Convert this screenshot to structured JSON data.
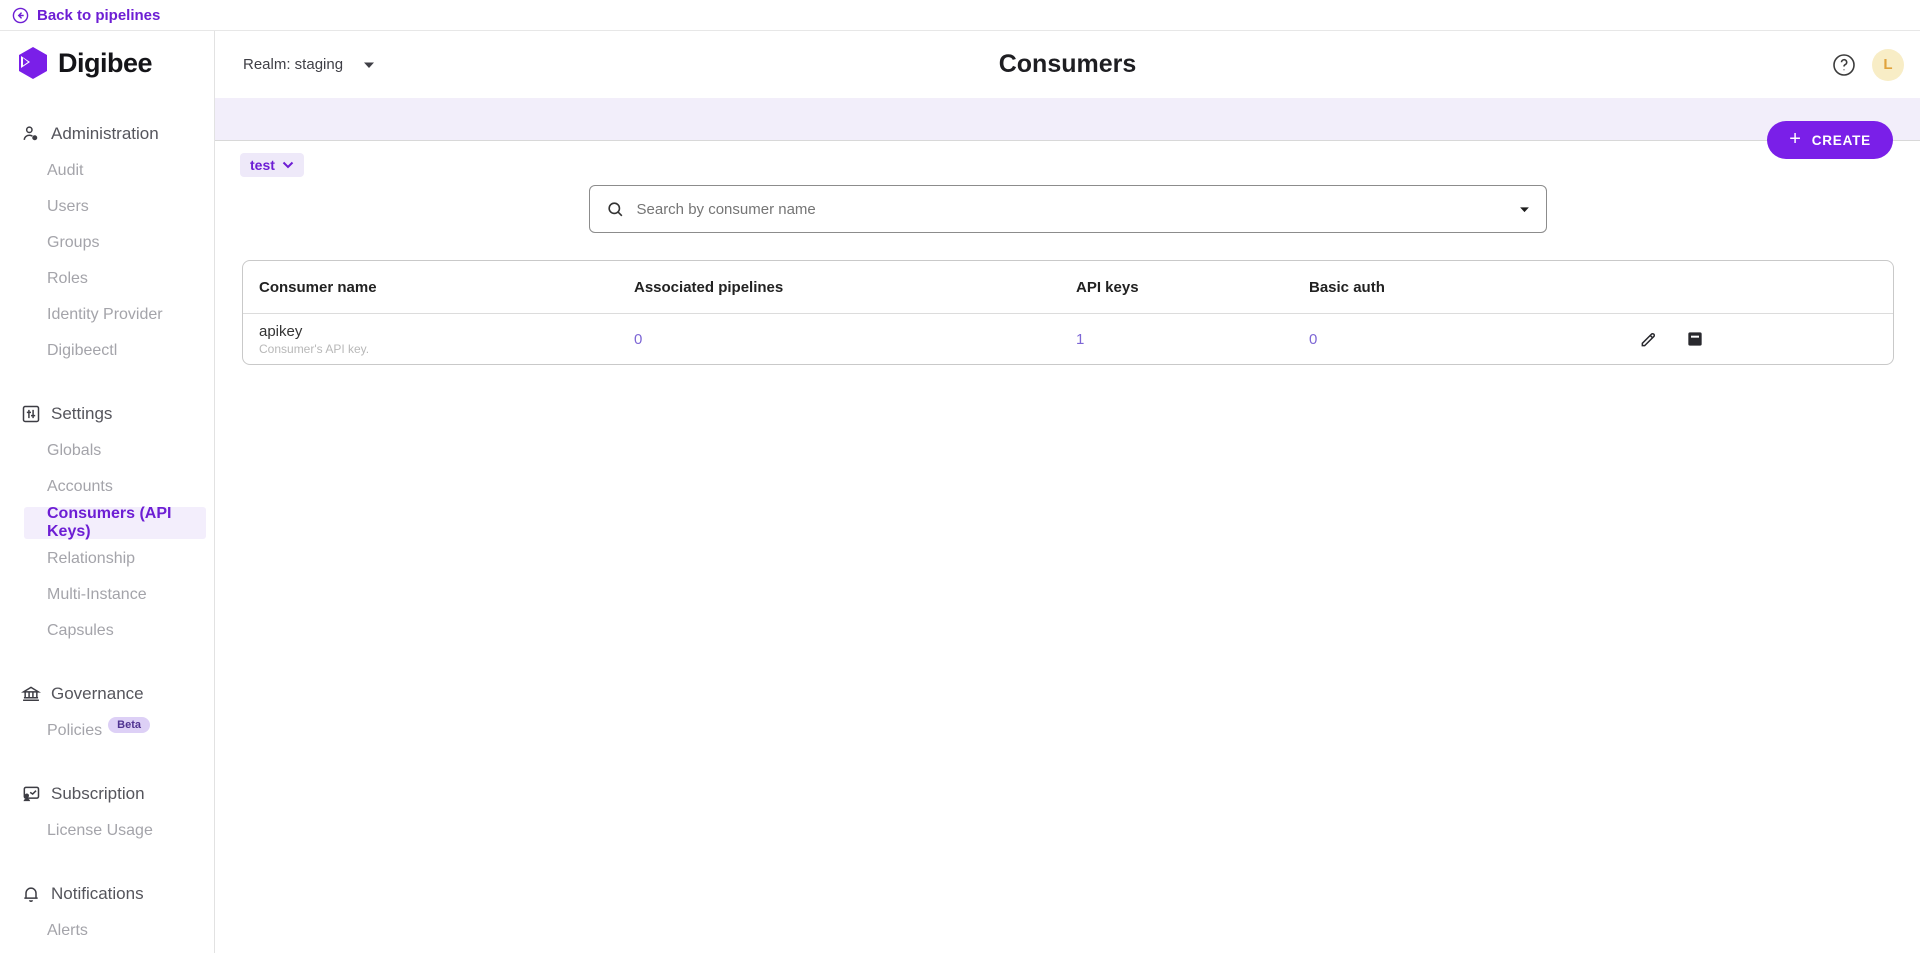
{
  "topbar": {
    "back_label": "Back to pipelines",
    "back_icon": "arrow-left-circle"
  },
  "brand": {
    "name": "Digibee",
    "logo_icon": "digibee-hexagon",
    "accent_color": "#7a1fe8"
  },
  "header": {
    "realm_label": "Realm: staging",
    "realm_caret_icon": "caret-down",
    "title": "Consumers",
    "help_icon": "question-mark-circle",
    "avatar_initial": "L"
  },
  "toolbar": {
    "create_label": "CREATE",
    "create_plus": "+",
    "env_chip_label": "test",
    "env_chip_icon": "chevron-down"
  },
  "search": {
    "placeholder": "Search by consumer name",
    "icon": "search-icon",
    "caret_icon": "caret-down"
  },
  "sidebar": {
    "sections": [
      {
        "label": "Administration",
        "icon": "user-admin-icon",
        "items": [
          {
            "label": "Audit"
          },
          {
            "label": "Users"
          },
          {
            "label": "Groups"
          },
          {
            "label": "Roles"
          },
          {
            "label": "Identity Provider"
          },
          {
            "label": "Digibeectl"
          }
        ]
      },
      {
        "label": "Settings",
        "icon": "sliders-box-icon",
        "items": [
          {
            "label": "Globals"
          },
          {
            "label": "Accounts"
          },
          {
            "label": "Consumers (API Keys)",
            "active": true
          },
          {
            "label": "Relationship"
          },
          {
            "label": "Multi-Instance"
          },
          {
            "label": "Capsules"
          }
        ]
      },
      {
        "label": "Governance",
        "icon": "bank-icon",
        "items": [
          {
            "label": "Policies",
            "badge": "Beta"
          }
        ]
      },
      {
        "label": "Subscription",
        "icon": "presentation-user-icon",
        "items": [
          {
            "label": "License Usage"
          }
        ]
      },
      {
        "label": "Notifications",
        "icon": "bell-icon",
        "items": [
          {
            "label": "Alerts"
          }
        ]
      }
    ]
  },
  "table": {
    "headers": [
      "Consumer name",
      "Associated pipelines",
      "API keys",
      "Basic auth"
    ],
    "rows": [
      {
        "name": "apikey",
        "description": "Consumer's API key.",
        "associated_pipelines": "0",
        "api_keys": "1",
        "basic_auth": "0",
        "actions": [
          "edit-icon",
          "archive-icon"
        ]
      }
    ]
  },
  "colors": {
    "accent": "#6d1ed4",
    "button_purple": "#7a1fe8",
    "band_lavender": "#f2eefa",
    "link_purple": "#7d66d5",
    "avatar_bg": "#f8edc6",
    "avatar_text": "#e0a33c"
  }
}
